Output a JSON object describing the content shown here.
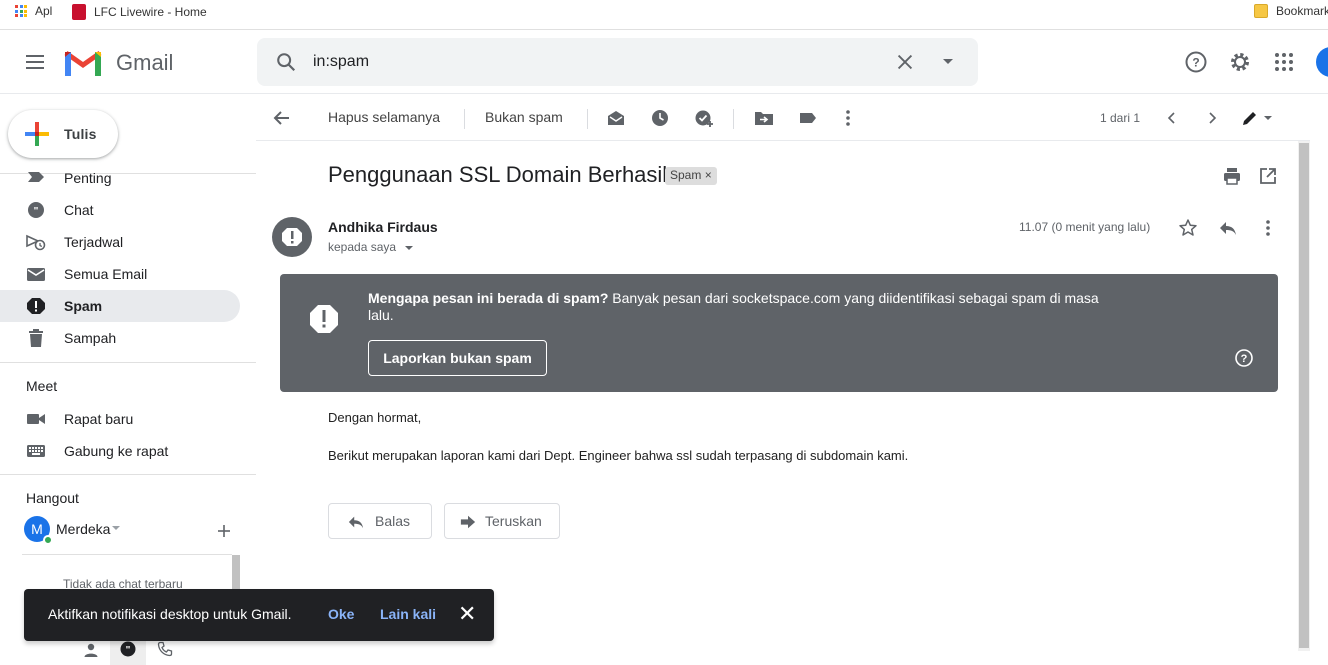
{
  "bookmarks": {
    "apps": "Apl",
    "lfc": "LFC Livewire - Home",
    "folder": "Bookmark"
  },
  "header": {
    "brand": "Gmail",
    "search_value": "in:spam"
  },
  "sidebar": {
    "compose_label": "Tulis",
    "items": [
      {
        "label": "Penting",
        "icon": "label-important-icon"
      },
      {
        "label": "Chat",
        "icon": "chat-icon"
      },
      {
        "label": "Terjadwal",
        "icon": "scheduled-send-icon"
      },
      {
        "label": "Semua Email",
        "icon": "all-mail-icon"
      },
      {
        "label": "Spam",
        "icon": "spam-icon",
        "active": true
      },
      {
        "label": "Sampah",
        "icon": "trash-icon"
      }
    ],
    "meet": {
      "title": "Meet",
      "new_meeting": "Rapat baru",
      "join_meeting": "Gabung ke rapat"
    },
    "hangout": {
      "title": "Hangout",
      "user_initial": "M",
      "user_name": "Merdeka",
      "no_chats": "Tidak ada chat terbaru"
    }
  },
  "toolbar": {
    "delete_forever": "Hapus selamanya",
    "not_spam": "Bukan spam",
    "pagination": "1 dari 1"
  },
  "message": {
    "subject": "Penggunaan SSL Domain Berhasil",
    "badge": "Spam",
    "badge_close": "×",
    "sender": "Andhika Firdaus",
    "recipient": "kepada saya",
    "time": "11.07 (0 menit yang lalu)",
    "warning_bold": "Mengapa pesan ini berada di spam?",
    "warning_text": " Banyak pesan dari socketspace.com yang diidentifikasi sebagai spam di masa lalu.",
    "warning_button": "Laporkan bukan spam",
    "greeting": "Dengan hormat,",
    "body": "Berikut merupakan laporan kami dari Dept. Engineer bahwa ssl sudah terpasang di subdomain kami.",
    "reply": "Balas",
    "forward": "Teruskan"
  },
  "snackbar": {
    "message": "Aktifkan notifikasi desktop untuk Gmail.",
    "ok": "Oke",
    "later": "Lain kali",
    "close": "✕"
  },
  "colors": {
    "accent": "#1a73e8",
    "spam_banner": "#5f6368",
    "snackbar": "#202124",
    "snackbar_action": "#8ab4f8"
  }
}
